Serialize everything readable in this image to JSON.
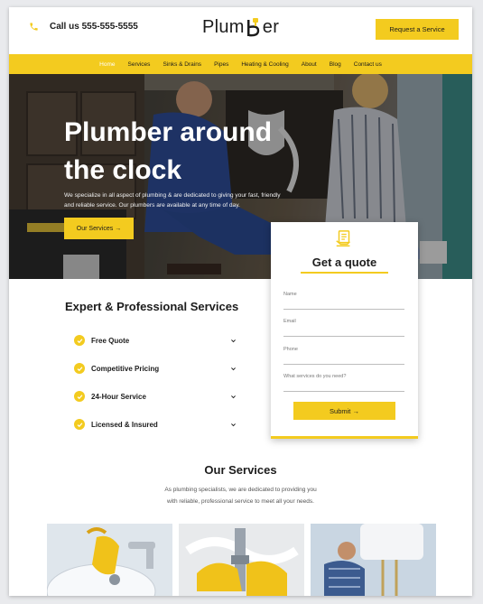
{
  "header": {
    "phone_text": "Call us 555-555-5555",
    "logo_prefix": "Plum",
    "logo_suffix": "er",
    "cta_label": "Request a Service"
  },
  "nav": {
    "items": [
      "Home",
      "Services",
      "Sinks & Drains",
      "Pipes",
      "Heating & Cooling",
      "About",
      "Blog",
      "Contact us"
    ],
    "active": "Home"
  },
  "hero": {
    "title_line1": "Plumber around",
    "title_line2": "the clock",
    "text": "We specialize in all aspect of plumbing & are dedicated to giving your fast, friendly and reliable service. Our plumbers are available at any time of day.",
    "button_label": "Our Services →"
  },
  "quote": {
    "title": "Get a quote",
    "fields": [
      {
        "label": "Name",
        "value": ""
      },
      {
        "label": "Email",
        "value": ""
      },
      {
        "label": "Phone",
        "value": ""
      },
      {
        "label": "What services do you need?",
        "value": ""
      }
    ],
    "submit_label": "Submit →"
  },
  "expert": {
    "heading": "Expert & Professional Services",
    "items": [
      "Free Quote",
      "Competitive Pricing",
      "24-Hour Service",
      "Licensed & Insured"
    ]
  },
  "our_services": {
    "title": "Our Services",
    "text_line1": "As plumbing specialists, we are dedicated to providing you",
    "text_line2": "with reliable, professional service to meet all your needs."
  },
  "colors": {
    "accent": "#f3cb1f",
    "text": "#1c1c1c",
    "page_bg": "#e9eaed"
  },
  "icons": {
    "phone": "phone-icon",
    "check": "check-icon",
    "chevron": "chevron-down-icon",
    "quote": "document-hand-icon"
  }
}
